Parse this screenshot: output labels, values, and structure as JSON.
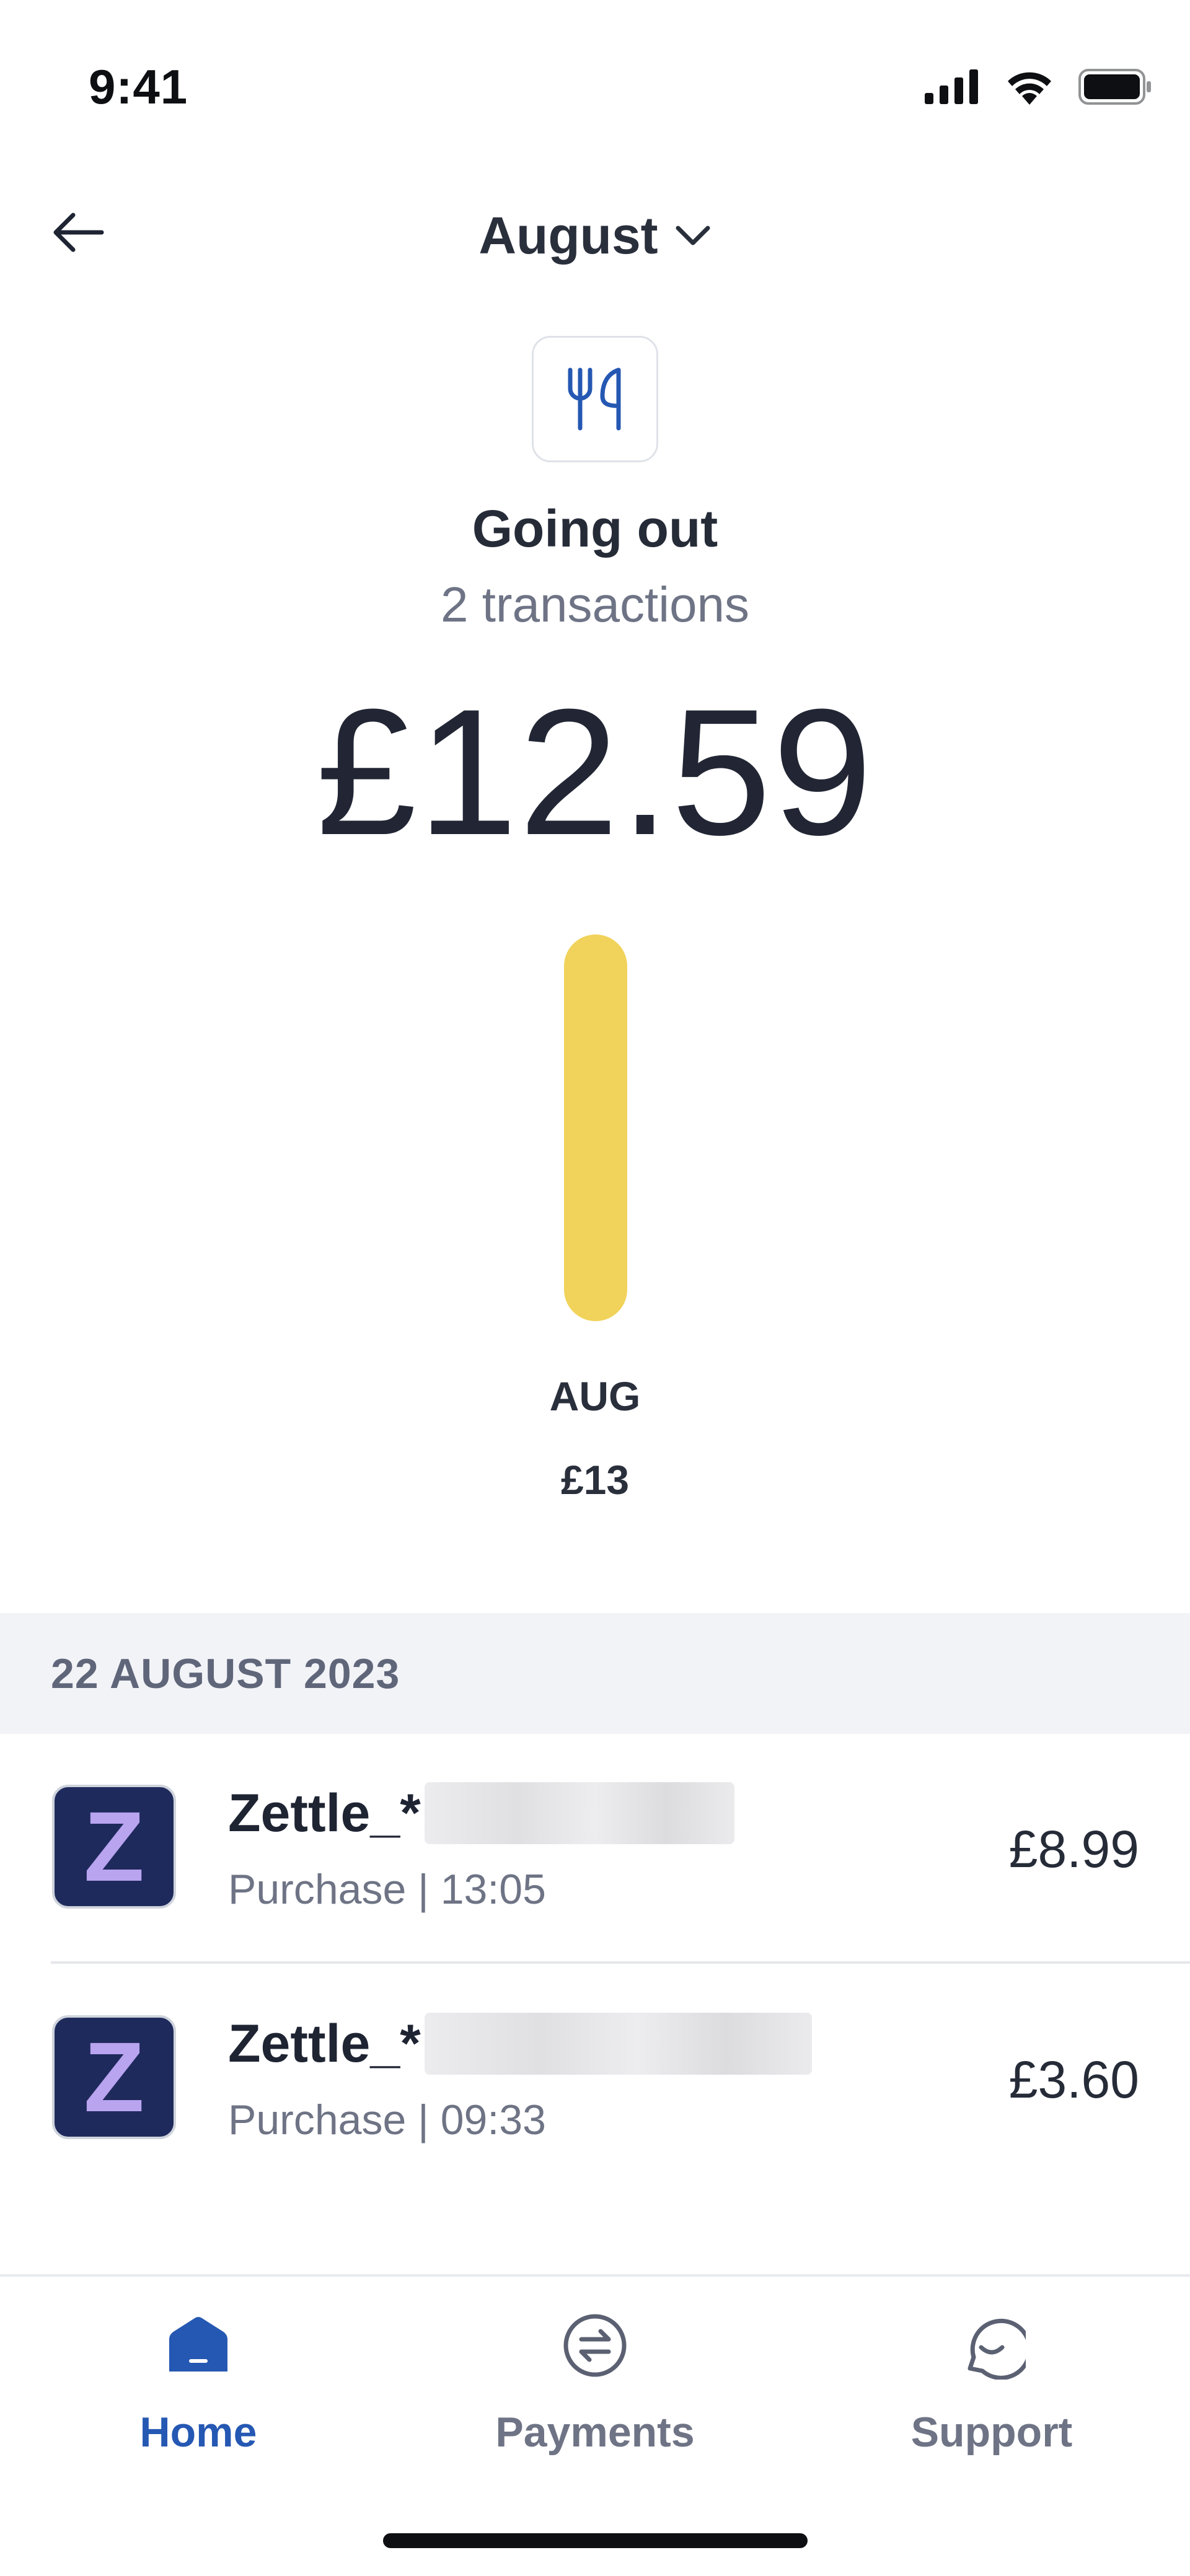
{
  "status_bar": {
    "time": "9:41"
  },
  "header": {
    "month": "August"
  },
  "category": {
    "icon": "cutlery-icon",
    "title": "Going out",
    "transactions_count": "2 transactions",
    "total": "£12.59"
  },
  "chart_data": {
    "type": "bar",
    "categories": [
      "AUG"
    ],
    "values": [
      13
    ],
    "value_labels": [
      "£13"
    ],
    "color": "#f1d35b"
  },
  "section": {
    "date": "22 AUGUST 2023"
  },
  "transactions": [
    {
      "avatar_letter": "Z",
      "merchant": "Zettle_*",
      "meta": "Purchase | 13:05",
      "amount": "£8.99"
    },
    {
      "avatar_letter": "Z",
      "merchant": "Zettle_*",
      "meta": "Purchase | 09:33",
      "amount": "£3.60"
    }
  ],
  "nav": {
    "home": "Home",
    "payments": "Payments",
    "support": "Support"
  },
  "colors": {
    "accent": "#2558b3",
    "bar": "#f1d35b",
    "avatar_bg": "#1f2a5c"
  }
}
